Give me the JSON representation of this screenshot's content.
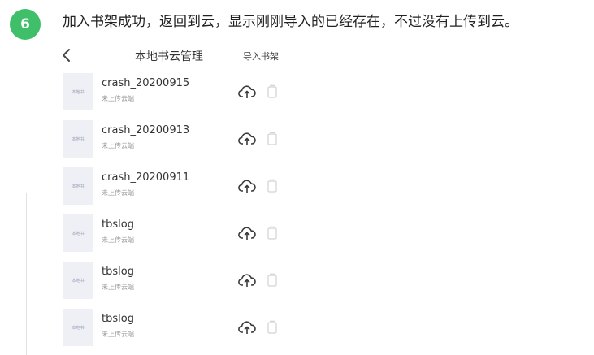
{
  "step": {
    "number": "6",
    "text": "加入书架成功，返回到云，显示刚刚导入的已经存在，不过没有上传到云。",
    "badge_color": "#3fbf6a"
  },
  "header": {
    "back_icon": "chevron-left-icon",
    "title": "本地书云管理",
    "import_label": "导入书架"
  },
  "books": [
    {
      "name": "crash_20200915",
      "status": "未上传云端",
      "cover_text": "本地书"
    },
    {
      "name": "crash_20200913",
      "status": "未上传云端",
      "cover_text": "本地书"
    },
    {
      "name": "crash_20200911",
      "status": "未上传云端",
      "cover_text": "本地书"
    },
    {
      "name": "tbslog",
      "status": "未上传云端",
      "cover_text": "本地书"
    },
    {
      "name": "tbslog",
      "status": "未上传云端",
      "cover_text": "本地书"
    },
    {
      "name": "tbslog",
      "status": "未上传云端",
      "cover_text": "本地书"
    }
  ],
  "icons": {
    "upload": "cloud-upload-icon",
    "delete": "trash-icon"
  }
}
